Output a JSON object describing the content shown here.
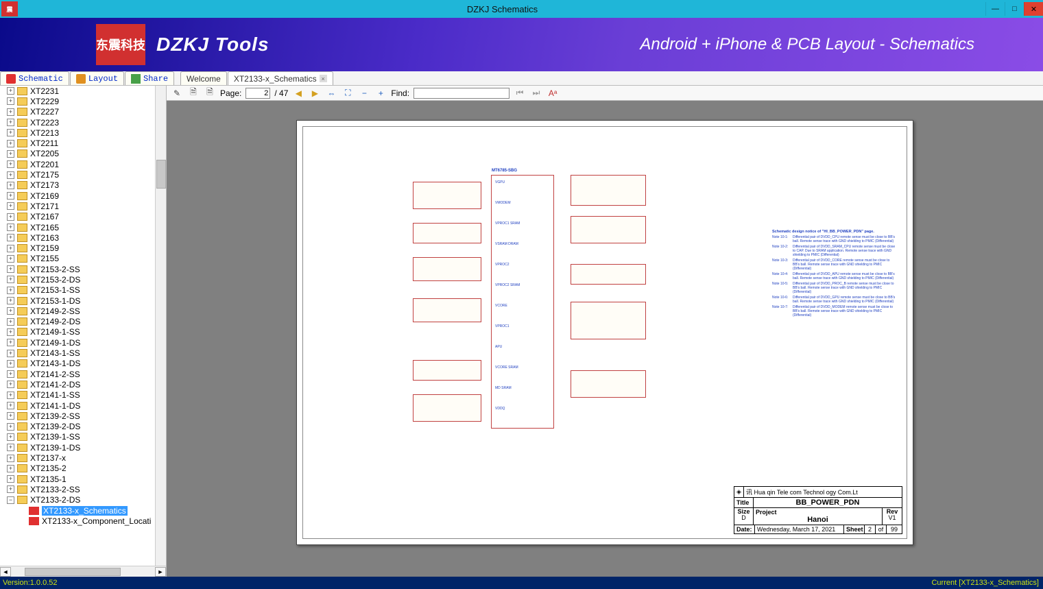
{
  "window": {
    "title": "DZKJ Schematics",
    "app_icon_text": "震"
  },
  "banner": {
    "logo_text": "东震科技",
    "brand": "DZKJ Tools",
    "tagline": "Android + iPhone & PCB Layout - Schematics"
  },
  "tabs": {
    "side": [
      {
        "icon": "pdf",
        "label": "Schematic"
      },
      {
        "icon": "pads",
        "label": "Layout"
      },
      {
        "icon": "share",
        "label": "Share"
      }
    ],
    "docs": [
      {
        "label": "Welcome",
        "closable": false
      },
      {
        "label": "XT2133-x_Schematics",
        "closable": true,
        "active": true
      }
    ]
  },
  "tree": {
    "items": [
      "XT2231",
      "XT2229",
      "XT2227",
      "XT2223",
      "XT2213",
      "XT2211",
      "XT2205",
      "XT2201",
      "XT2175",
      "XT2173",
      "XT2169",
      "XT2171",
      "XT2167",
      "XT2165",
      "XT2163",
      "XT2159",
      "XT2155",
      "XT2153-2-SS",
      "XT2153-2-DS",
      "XT2153-1-SS",
      "XT2153-1-DS",
      "XT2149-2-SS",
      "XT2149-2-DS",
      "XT2149-1-SS",
      "XT2149-1-DS",
      "XT2143-1-SS",
      "XT2143-1-DS",
      "XT2141-2-SS",
      "XT2141-2-DS",
      "XT2141-1-SS",
      "XT2141-1-DS",
      "XT2139-2-SS",
      "XT2139-2-DS",
      "XT2139-1-SS",
      "XT2139-1-DS",
      "XT2137-x",
      "XT2135-2",
      "XT2135-1",
      "XT2133-2-SS"
    ],
    "expanded": {
      "label": "XT2133-2-DS",
      "children": [
        {
          "label": "XT2133-x_Schematics",
          "selected": true
        },
        {
          "label": "XT2133-x_Component_Locati"
        }
      ]
    }
  },
  "toolbar": {
    "page_label": "Page:",
    "page_current": "2",
    "page_sep": " / 47",
    "find_label": "Find:",
    "find_value": ""
  },
  "schematic": {
    "chip": "MT6785-SBG",
    "rails": [
      "VGPU",
      "VMODEM",
      "VPROC1 SRAM",
      "VSRAM DRAM",
      "VPROC2",
      "VPROC2 SRAM",
      "VCORE",
      "VPROC1",
      "APU",
      "VCORE SRAM",
      "MD SRAM",
      "VDDQ"
    ],
    "notes_title": "Schematic design notice of \"HI_BB_POWER_PDN\" page.",
    "notes": [
      {
        "n": "Note 10-1:",
        "t": "Differential pair of DVDD_CPU remote sense must be close to BB's ball. Remote sense trace with GND shielding to PMIC (Differential)"
      },
      {
        "n": "Note 10-2:",
        "t": "Differential pair of DVDD_SRAM_CPU remote sense must be close to CAP. Due to SRAM application. Remote sense trace with GND shielding to PMIC (Differential)"
      },
      {
        "n": "Note 10-3:",
        "t": "Differential pair of DVDD_CORE remote sense must be close to BB's ball. Remote sense trace with GND shielding to PMIC (Differential)"
      },
      {
        "n": "Note 10-4:",
        "t": "Differential pair of DVDD_APU remote sense must be close to BB's ball. Remote sense trace with GND shielding to PMIC (Differential)"
      },
      {
        "n": "Note 10-5:",
        "t": "Differential pair of DVDD_PROC_B remote sense must be close to BB's ball. Remote sense trace with GND shielding to PMIC (Differential)"
      },
      {
        "n": "Note 10-6:",
        "t": "Differential pair of DVDD_GPU remote sense must be close to BB's ball. Remote sense trace with GND shielding to PMIC (Differential)"
      },
      {
        "n": "Note 10-7:",
        "t": "Differential pair of DVDD_MODEM remote sense must be close to BB's ball. Remote sense trace with GND shielding to PMIC (Differential)"
      }
    ]
  },
  "titleblock": {
    "company": "讯 Hua   qin Tele   com Technol   ogy Com.Lt",
    "title_label": "Title",
    "title": "BB_POWER_PDN",
    "size_label": "Size",
    "size": "D",
    "project_label": "Project",
    "project": "Hanoi",
    "rev_label": "Rev",
    "rev": "V1",
    "date_label": "Date:",
    "date": "Wednesday, March 17, 2021",
    "sheet_label": "Sheet",
    "sheet_n": "2",
    "sheet_of": "of",
    "sheet_total": "99"
  },
  "status": {
    "version": "Version:1.0.0.52",
    "current": "Current [XT2133-x_Schematics]"
  }
}
